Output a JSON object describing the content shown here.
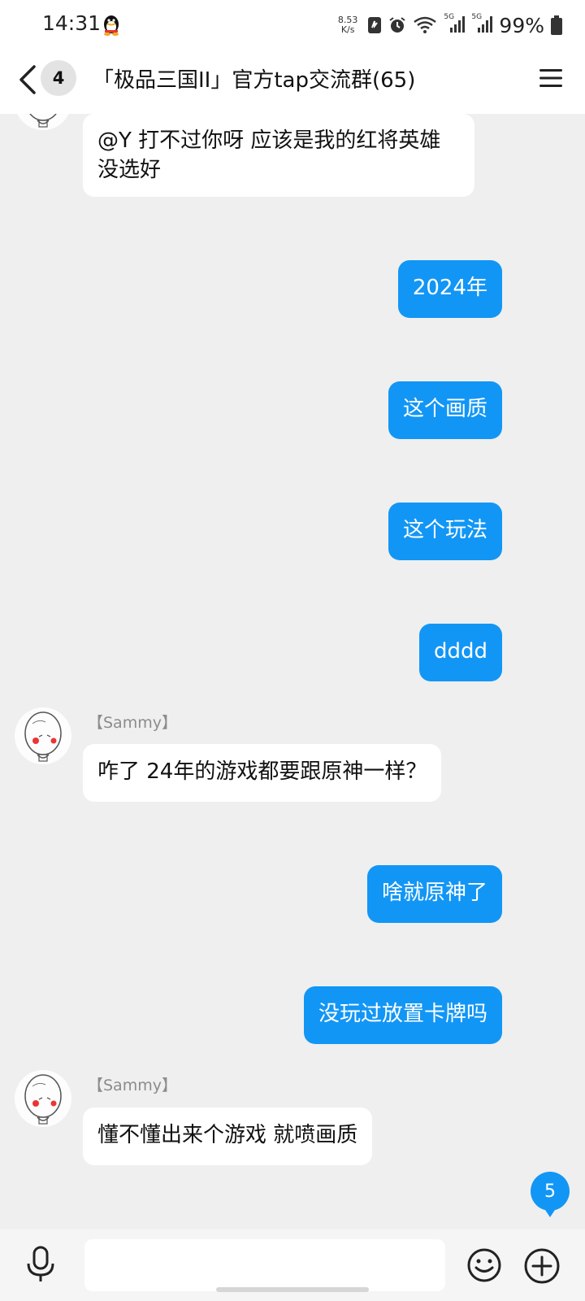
{
  "status_bar": {
    "time": "14:31",
    "net_speed_value": "8.53",
    "net_speed_unit": "K/s",
    "signal_1_label": "5G",
    "signal_2_label": "5G",
    "battery": "99%"
  },
  "header": {
    "unread_count": "4",
    "title": "「极品三国II」官方tap交流群(65)"
  },
  "messages": [
    {
      "direction": "in",
      "text": "@Y 打不过你呀  应该是我的红将英雄没选好"
    },
    {
      "direction": "out",
      "text": "2024年"
    },
    {
      "direction": "out",
      "text": "这个画质"
    },
    {
      "direction": "out",
      "text": "这个玩法"
    },
    {
      "direction": "out",
      "text": "dddd"
    },
    {
      "direction": "in",
      "sender": "【Sammy】",
      "text": "咋了 24年的游戏都要跟原神一样？"
    },
    {
      "direction": "out",
      "text": "啥就原神了"
    },
    {
      "direction": "out",
      "text": "没玩过放置卡牌吗"
    },
    {
      "direction": "in",
      "sender": "【Sammy】",
      "text": "懂不懂出来个游戏 就喷画质"
    }
  ],
  "new_message_count": "5",
  "input": {
    "placeholder": ""
  },
  "colors": {
    "accent": "#1296f5",
    "background": "#efefef",
    "incoming_bubble": "#ffffff"
  },
  "icons": [
    "qq-penguin-icon",
    "back-arrow-icon",
    "menu-icon",
    "microphone-icon",
    "emoji-icon",
    "plus-icon",
    "wifi-icon",
    "alarm-icon",
    "battery-icon"
  ]
}
